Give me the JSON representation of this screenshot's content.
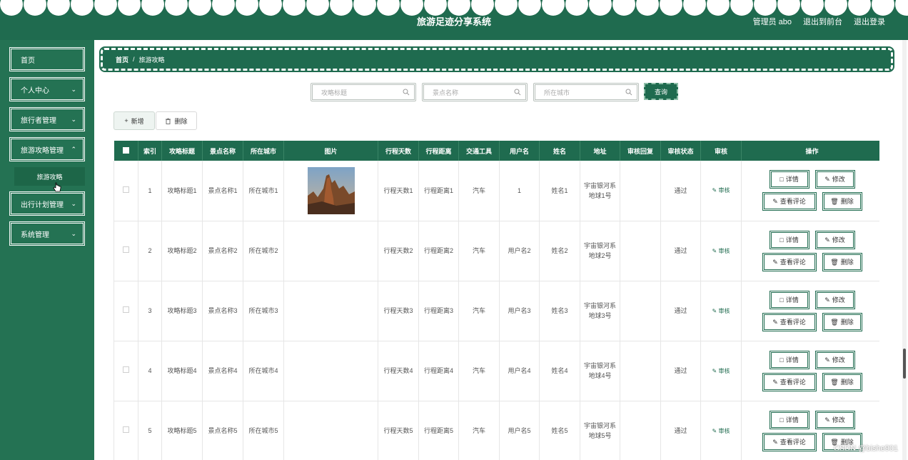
{
  "header": {
    "title": "旅游足迹分享系统",
    "user": "管理员 abo",
    "to_front": "退出到前台",
    "logout": "退出登录"
  },
  "sidebar": {
    "items": [
      {
        "label": "首页"
      },
      {
        "label": "个人中心"
      },
      {
        "label": "旅行者管理"
      },
      {
        "label": "旅游攻略管理"
      },
      {
        "label": "出行计划管理"
      },
      {
        "label": "系统管理"
      }
    ],
    "sub_item": "旅游攻略"
  },
  "breadcrumb": {
    "home": "首页",
    "sep": "/",
    "current": "旅游攻略"
  },
  "search": {
    "title_placeholder": "攻略标题",
    "spot_placeholder": "景点名称",
    "city_placeholder": "所在城市",
    "query": "查询"
  },
  "actions": {
    "add": "新增",
    "delete": "删除"
  },
  "table": {
    "headers": [
      "",
      "索引",
      "攻略标题",
      "景点名称",
      "所在城市",
      "图片",
      "行程天数",
      "行程距离",
      "交通工具",
      "用户名",
      "姓名",
      "地址",
      "审核回复",
      "审核状态",
      "审核",
      "操作"
    ],
    "rows": [
      {
        "index": "1",
        "title": "攻略标题1",
        "spot": "景点名称1",
        "city": "所在城市1",
        "days": "行程天数1",
        "distance": "行程距离1",
        "transport": "汽车",
        "username": "1",
        "name": "姓名1",
        "address": "宇宙银河系地球1号",
        "reply": "",
        "status": "通过",
        "audit": "审核"
      },
      {
        "index": "2",
        "title": "攻略标题2",
        "spot": "景点名称2",
        "city": "所在城市2",
        "days": "行程天数2",
        "distance": "行程距离2",
        "transport": "汽车",
        "username": "用户名2",
        "name": "姓名2",
        "address": "宇宙银河系地球2号",
        "reply": "",
        "status": "通过",
        "audit": "审核"
      },
      {
        "index": "3",
        "title": "攻略标题3",
        "spot": "景点名称3",
        "city": "所在城市3",
        "days": "行程天数3",
        "distance": "行程距离3",
        "transport": "汽车",
        "username": "用户名3",
        "name": "姓名3",
        "address": "宇宙银河系地球3号",
        "reply": "",
        "status": "通过",
        "audit": "审核"
      },
      {
        "index": "4",
        "title": "攻略标题4",
        "spot": "景点名称4",
        "city": "所在城市4",
        "days": "行程天数4",
        "distance": "行程距离4",
        "transport": "汽车",
        "username": "用户名4",
        "name": "姓名4",
        "address": "宇宙银河系地球4号",
        "reply": "",
        "status": "通过",
        "audit": "审核"
      },
      {
        "index": "5",
        "title": "攻略标题5",
        "spot": "景点名称5",
        "city": "所在城市5",
        "days": "行程天数5",
        "distance": "行程距离5",
        "transport": "汽车",
        "username": "用户名5",
        "name": "姓名5",
        "address": "宇宙银河系地球5号",
        "reply": "",
        "status": "通过",
        "audit": "审核"
      }
    ],
    "ops": {
      "detail": "详情",
      "edit": "修改",
      "comments": "查看评论",
      "delete": "删除"
    }
  },
  "watermark": "CSDN @bishe901",
  "colors": {
    "primary": "#1f6b4f",
    "sidebar": "#247253"
  }
}
